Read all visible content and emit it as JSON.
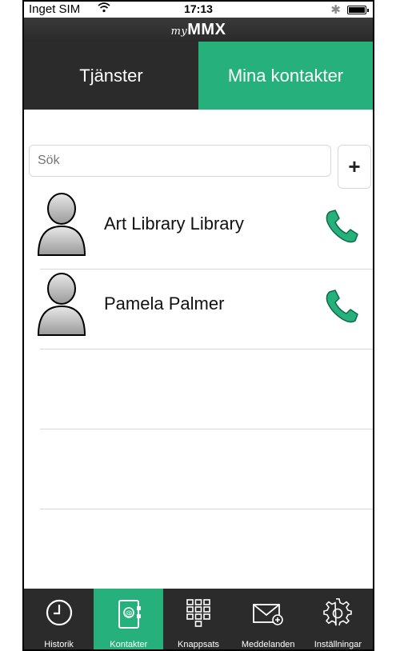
{
  "status_bar": {
    "carrier": "Inget SIM",
    "time": "17:13"
  },
  "app": {
    "logo_prefix": "my",
    "logo_main": "MMX"
  },
  "segments": [
    {
      "label": "Tjänster",
      "active": false
    },
    {
      "label": "Mina kontakter",
      "active": true
    }
  ],
  "search": {
    "placeholder": "Sök",
    "add_label": "+"
  },
  "contacts": [
    {
      "name": "Art Library Library"
    },
    {
      "name": "Pamela Palmer"
    }
  ],
  "tabbar": [
    {
      "label": "Historik",
      "icon": "clock-icon",
      "active": false
    },
    {
      "label": "Kontakter",
      "icon": "contacts-book-icon",
      "active": true
    },
    {
      "label": "Knappsats",
      "icon": "keypad-icon",
      "active": false
    },
    {
      "label": "Meddelanden",
      "icon": "envelope-icon",
      "active": false
    },
    {
      "label": "Inställningar",
      "icon": "gear-icon",
      "active": false
    }
  ],
  "colors": {
    "accent": "#26b07c",
    "dark": "#2b2b2b"
  }
}
